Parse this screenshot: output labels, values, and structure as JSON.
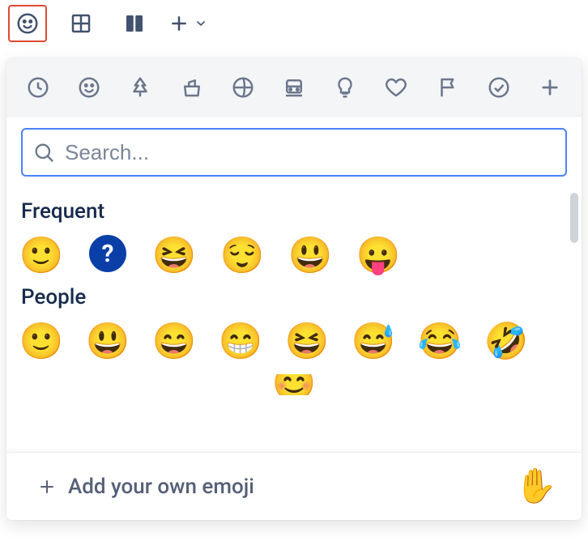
{
  "toolbar": {
    "emoji_button": "emoji-face-icon",
    "table_button": "table-icon",
    "columns_button": "columns-icon",
    "add_button": "plus-icon"
  },
  "categories": [
    "recent-icon",
    "people-icon",
    "nature-icon",
    "food-icon",
    "activity-icon",
    "travel-icon",
    "objects-icon",
    "symbols-icon",
    "flags-icon",
    "productivity-icon",
    "custom-add-icon"
  ],
  "search": {
    "placeholder": "Search...",
    "value": ""
  },
  "sections": {
    "frequent": {
      "title": "Frequent",
      "items": [
        "🙂",
        "?",
        "😆",
        "😌",
        "😃",
        "😛"
      ]
    },
    "people": {
      "title": "People",
      "items": [
        "🙂",
        "😃",
        "😄",
        "😁",
        "😆",
        "😅",
        "😂",
        "🤣"
      ]
    }
  },
  "footer": {
    "add_label": "Add your own emoji",
    "preview_emoji": "✋"
  }
}
